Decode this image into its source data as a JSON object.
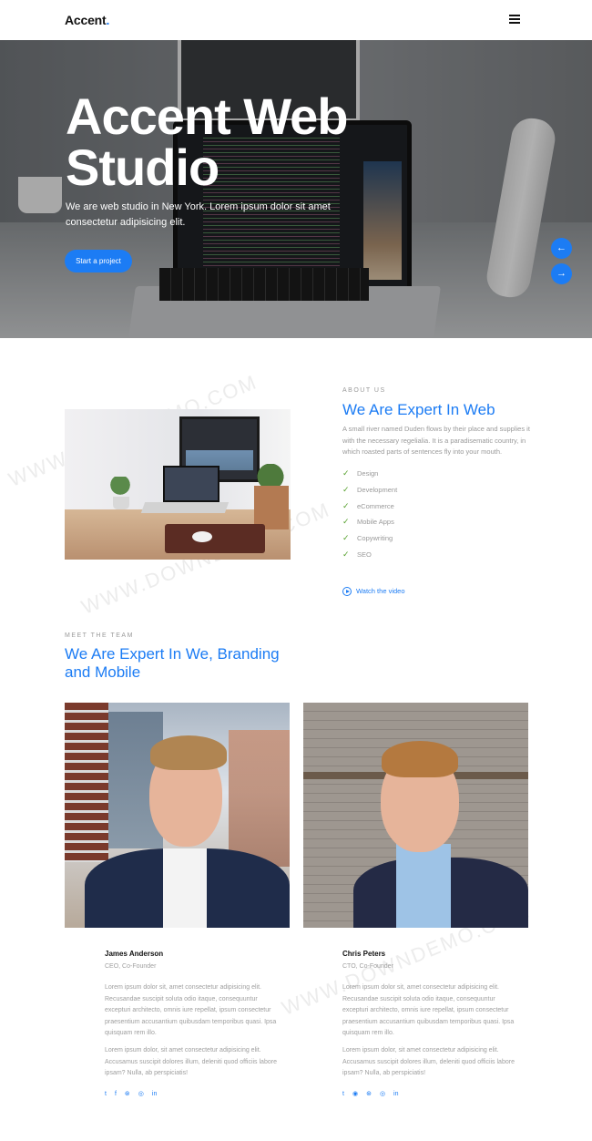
{
  "header": {
    "logo": "Accent",
    "logo_dot": "."
  },
  "hero": {
    "title": "Accent Web Studio",
    "text": "We are web studio in New York. Lorem ipsum dolor sit amet consectetur adipisicing elit.",
    "cta": "Start a project",
    "prev_icon": "←",
    "next_icon": "→"
  },
  "about": {
    "eyebrow": "ABOUT US",
    "heading": "We Are Expert In Web",
    "text": "A small river named Duden flows by their place and supplies it with the necessary regelialia. It is a paradisematic country, in which roasted parts of sentences fly into your mouth.",
    "features": [
      "Design",
      "Development",
      "eCommerce",
      "Mobile Apps",
      "Copywriting",
      "SEO"
    ],
    "check_icon": "✓",
    "video_link": "Watch the video"
  },
  "team": {
    "eyebrow": "MEET THE TEAM",
    "heading": "We Are Expert In We, Branding and Mobile",
    "members": [
      {
        "name": "James Anderson",
        "role": "CEO, Co-Founder",
        "bio1": "Lorem ipsum dolor sit, amet consectetur adipisicing elit. Recusandae suscipit soluta odio itaque, consequuntur excepturi architecto, omnis iure repellat, ipsum consectetur praesentium accusantium quibusdam temporibus quasi. Ipsa quisquam rem illo.",
        "bio2": "Lorem ipsum dolor, sit amet consectetur adipisicing elit. Accusamus suscipit dolores illum, deleniti quod officiis labore ipsam? Nulla, ab perspiciatis!",
        "social": [
          "t",
          "f",
          "⊛",
          "◎",
          "in"
        ]
      },
      {
        "name": "Chris Peters",
        "role": "CTO, Co-Founder",
        "bio1": "Lorem ipsum dolor sit, amet consectetur adipisicing elit. Recusandae suscipit soluta odio itaque, consequuntur excepturi architecto, omnis iure repellat, ipsum consectetur praesentium accusantium quibusdam temporibus quasi. Ipsa quisquam rem illo.",
        "bio2": "Lorem ipsum dolor, sit amet consectetur adipisicing elit. Accusamus suscipit dolores illum, deleniti quod officiis labore ipsam? Nulla, ab perspiciatis!",
        "social": [
          "t",
          "◉",
          "⊛",
          "◎",
          "in"
        ]
      }
    ]
  },
  "watermark": "WWW.DOWNDEMO.COM",
  "colors": {
    "accent": "#1c7cf4",
    "check": "#55a02c"
  }
}
